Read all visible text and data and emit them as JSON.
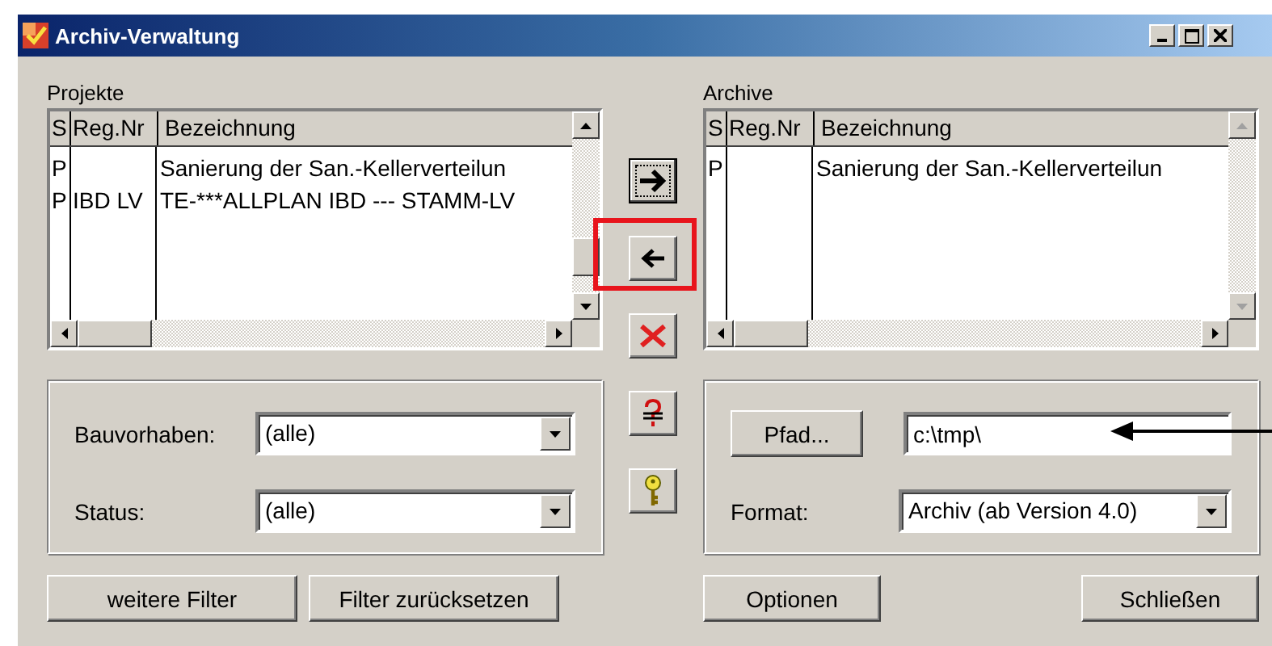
{
  "window": {
    "title": "Archiv-Verwaltung"
  },
  "lists": [
    {
      "label": "Projekte",
      "scroll_disabled": false,
      "columns": [
        "S",
        "Reg.Nr",
        "Bezeichnung"
      ],
      "rows": [
        {
          "s": "P",
          "bezeichnung": "Sanierung der San.-Kellerverteilun"
        },
        {
          "s": "P",
          "reg_nr": "IBD LV",
          "bezeichnung": "TE-***ALLPLAN IBD --- STAMM-LV"
        }
      ]
    },
    {
      "label": "Archive",
      "scroll_disabled": true,
      "columns": [
        "S",
        "Reg.Nr",
        "Bezeichnung"
      ],
      "rows": [
        {
          "s": "P",
          "bezeichnung": "Sanierung der San.-Kellerverteilun"
        }
      ]
    }
  ],
  "transfer_buttons": [
    {
      "kind": "right",
      "focused": true,
      "highlighted": false
    },
    {
      "kind": "left",
      "focused": false,
      "highlighted": true
    },
    {
      "kind": "delete",
      "focused": false,
      "highlighted": false
    },
    {
      "kind": "strike",
      "focused": false,
      "highlighted": false
    },
    {
      "kind": "key",
      "focused": false,
      "highlighted": false
    }
  ],
  "filters": [
    {
      "label": "Bauvorhaben:",
      "value": "(alle)"
    },
    {
      "label": "Status:",
      "value": "(alle)"
    }
  ],
  "filter_buttons": [
    "weitere Filter",
    "Filter zurücksetzen"
  ],
  "path": {
    "button": "Pfad...",
    "value": "c:\\tmp\\",
    "pointer": true
  },
  "format": {
    "label": "Format:",
    "value": "Archiv (ab Version 4.0)"
  },
  "buttons": [
    "Optionen",
    "Schließen"
  ]
}
